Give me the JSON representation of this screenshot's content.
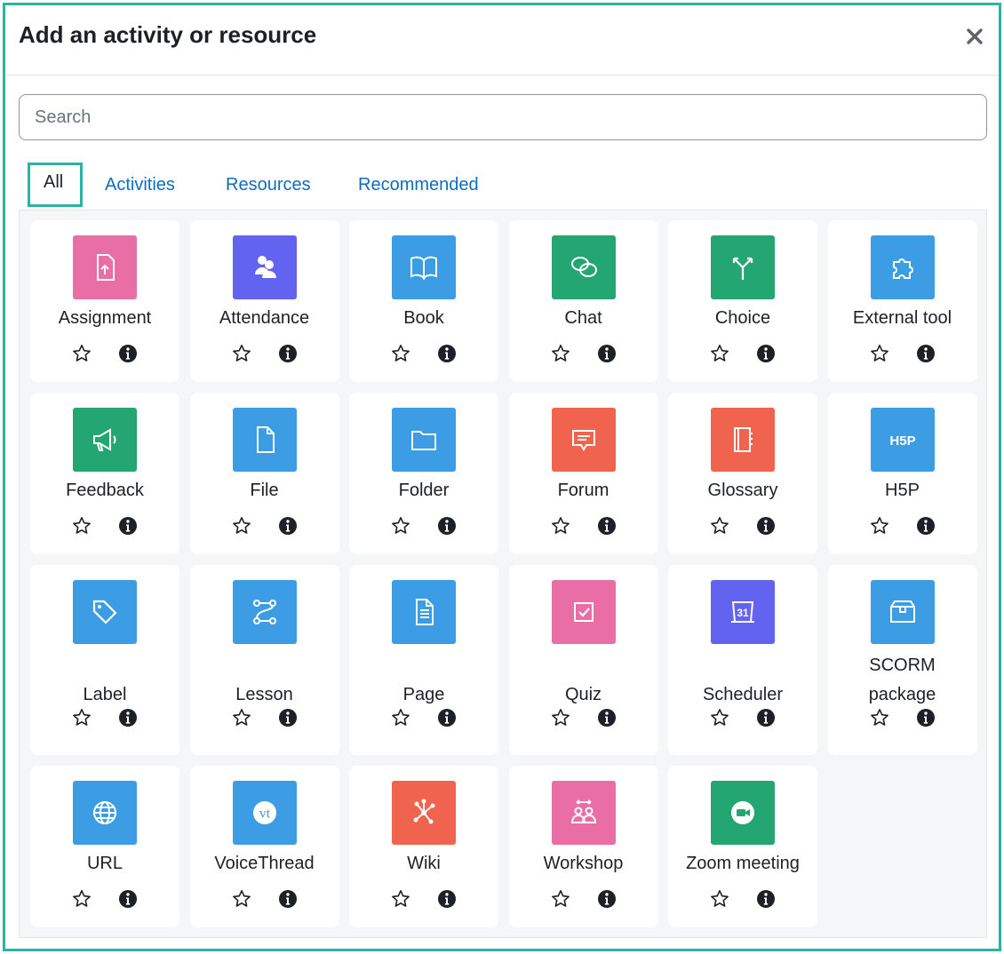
{
  "modal": {
    "title": "Add an activity or resource"
  },
  "search": {
    "placeholder": "Search",
    "value": ""
  },
  "tabs": [
    {
      "label": "All",
      "active": true
    },
    {
      "label": "Activities",
      "active": false
    },
    {
      "label": "Resources",
      "active": false
    },
    {
      "label": "Recommended",
      "active": false
    }
  ],
  "items": [
    {
      "label": "Assignment",
      "icon": "assignment-icon",
      "color": "#e86ea5"
    },
    {
      "label": "Attendance",
      "icon": "attendance-icon",
      "color": "#6263f0"
    },
    {
      "label": "Book",
      "icon": "book-icon",
      "color": "#3d9de4"
    },
    {
      "label": "Chat",
      "icon": "chat-icon",
      "color": "#24a672"
    },
    {
      "label": "Choice",
      "icon": "choice-icon",
      "color": "#24a672"
    },
    {
      "label": "External tool",
      "icon": "puzzle-icon",
      "color": "#3d9de4"
    },
    {
      "label": "Feedback",
      "icon": "megaphone-icon",
      "color": "#24a672"
    },
    {
      "label": "File",
      "icon": "file-icon",
      "color": "#3d9de4"
    },
    {
      "label": "Folder",
      "icon": "folder-icon",
      "color": "#3d9de4"
    },
    {
      "label": "Forum",
      "icon": "forum-icon",
      "color": "#f0634e"
    },
    {
      "label": "Glossary",
      "icon": "glossary-icon",
      "color": "#f0634e"
    },
    {
      "label": "H5P",
      "icon": "h5p-icon",
      "color": "#3d9de4",
      "icon_text": "H5P"
    },
    {
      "label": "Label",
      "icon": "tag-icon",
      "color": "#3d9de4"
    },
    {
      "label": "Lesson",
      "icon": "lesson-icon",
      "color": "#3d9de4"
    },
    {
      "label": "Page",
      "icon": "page-icon",
      "color": "#3d9de4"
    },
    {
      "label": "Quiz",
      "icon": "quiz-icon",
      "color": "#e86ea5"
    },
    {
      "label": "Scheduler",
      "icon": "calendar-icon",
      "color": "#6263f0",
      "icon_text": "31"
    },
    {
      "label": "SCORM package",
      "icon": "package-icon",
      "color": "#3d9de4"
    },
    {
      "label": "URL",
      "icon": "globe-icon",
      "color": "#3d9de4"
    },
    {
      "label": "VoiceThread",
      "icon": "voicethread-icon",
      "color": "#3d9de4",
      "icon_text": "vt"
    },
    {
      "label": "Wiki",
      "icon": "wiki-icon",
      "color": "#f0634e"
    },
    {
      "label": "Workshop",
      "icon": "workshop-icon",
      "color": "#e86ea5"
    },
    {
      "label": "Zoom meeting",
      "icon": "video-camera-icon",
      "color": "#24a672"
    }
  ]
}
